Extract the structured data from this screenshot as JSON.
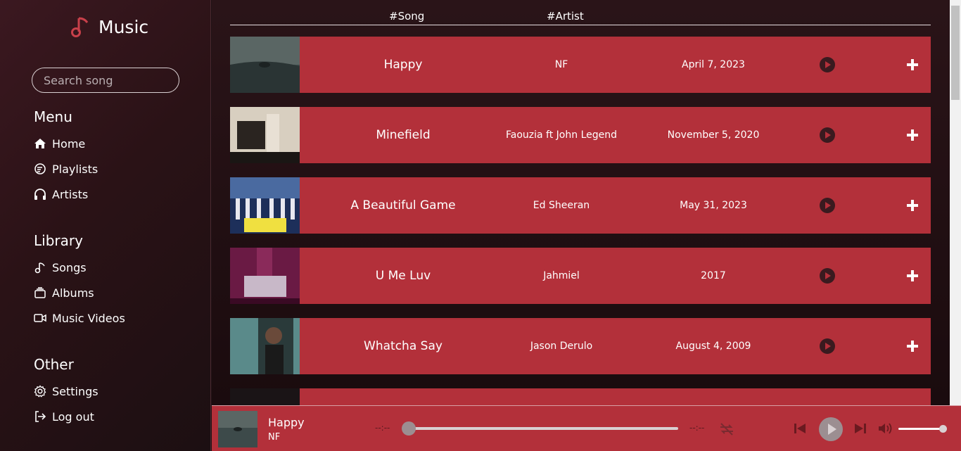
{
  "app": {
    "title": "Music"
  },
  "search": {
    "placeholder": "Search song"
  },
  "sidebar": {
    "menu_title": "Menu",
    "menu_items": [
      {
        "label": "Home",
        "icon": "home-icon"
      },
      {
        "label": "Playlists",
        "icon": "playlist-icon"
      },
      {
        "label": "Artists",
        "icon": "headphones-icon"
      }
    ],
    "library_title": "Library",
    "library_items": [
      {
        "label": "Songs",
        "icon": "music-note-icon"
      },
      {
        "label": "Albums",
        "icon": "album-icon"
      },
      {
        "label": "Music Videos",
        "icon": "video-icon"
      }
    ],
    "other_title": "Other",
    "other_items": [
      {
        "label": "Settings",
        "icon": "gear-icon"
      },
      {
        "label": "Log out",
        "icon": "logout-icon"
      }
    ]
  },
  "table": {
    "headers": {
      "song": "#Song",
      "artist": "#Artist"
    },
    "rows": [
      {
        "song": "Happy",
        "artist": "NF",
        "date": "April 7, 2023"
      },
      {
        "song": "Minefield",
        "artist": "Faouzia ft John Legend",
        "date": "November 5, 2020"
      },
      {
        "song": "A Beautiful Game",
        "artist": "Ed Sheeran",
        "date": "May 31, 2023"
      },
      {
        "song": "U Me Luv",
        "artist": "Jahmiel",
        "date": "2017"
      },
      {
        "song": "Whatcha Say",
        "artist": "Jason Derulo",
        "date": "August 4, 2009"
      }
    ]
  },
  "player": {
    "title": "Happy",
    "artist": "NF",
    "time_current": "--:--",
    "time_total": "--:--",
    "progress": 0,
    "volume": 0.95
  },
  "colors": {
    "accent": "#b3303a",
    "sidebar_bg": "#2a1216",
    "main_bg": "#1a0b0e"
  }
}
